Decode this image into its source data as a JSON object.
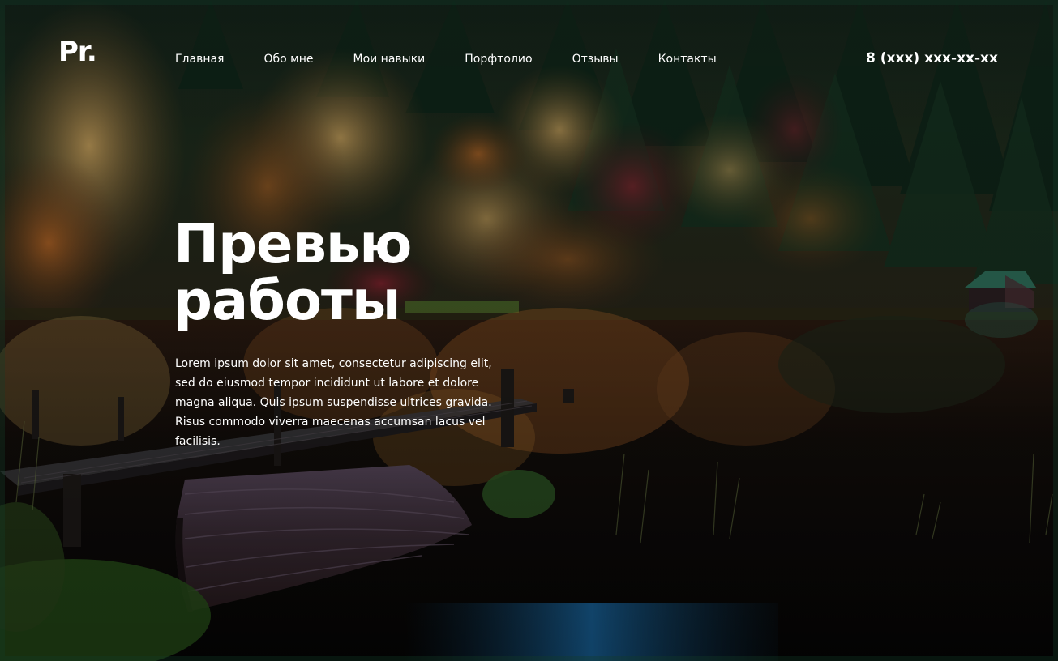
{
  "header": {
    "logo": "Pr.",
    "nav": [
      {
        "label": "Главная"
      },
      {
        "label": "Обо мне"
      },
      {
        "label": "Мои навыки"
      },
      {
        "label": "Порфтолио"
      },
      {
        "label": "Отзывы"
      },
      {
        "label": "Контакты"
      }
    ],
    "phone": "8 (xxx) xxx-xx-xx"
  },
  "hero": {
    "title_line1": "Превью",
    "title_line2": "работы",
    "text": "Lorem ipsum dolor sit amet, consectetur adipiscing elit, sed do eiusmod tempor incididunt ut labore et dolore magna aliqua. Quis ipsum suspendisse ultrices gravida. Risus commodo viverra maecenas accumsan lacus vel facilisis."
  },
  "colors": {
    "text": "#ffffff",
    "forest_dark": "#0f1a12",
    "autumn_orange": "#b86a2a",
    "autumn_gold": "#c9a055",
    "water": "#0a0b0a",
    "accent_blue": "#1b6fae"
  }
}
